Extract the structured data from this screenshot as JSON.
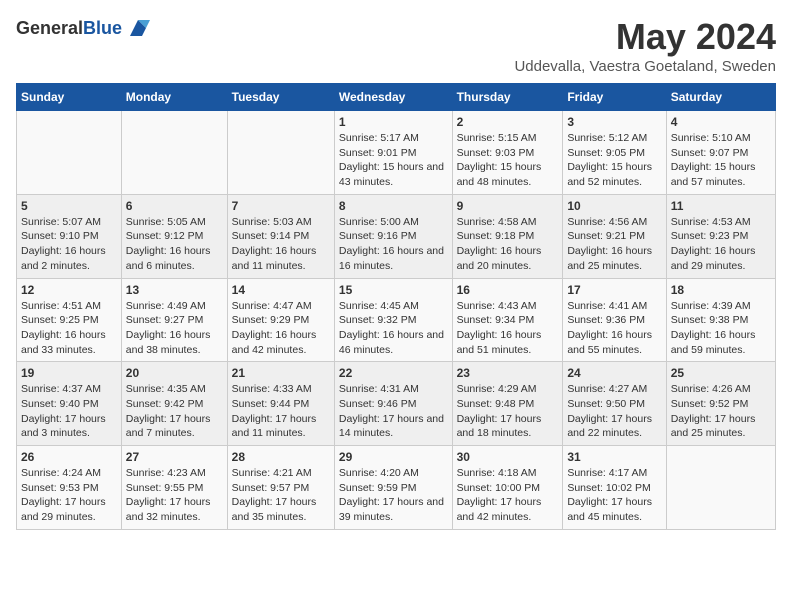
{
  "logo": {
    "general": "General",
    "blue": "Blue"
  },
  "title": "May 2024",
  "subtitle": "Uddevalla, Vaestra Goetaland, Sweden",
  "weekdays": [
    "Sunday",
    "Monday",
    "Tuesday",
    "Wednesday",
    "Thursday",
    "Friday",
    "Saturday"
  ],
  "weeks": [
    [
      {
        "day": "",
        "info": ""
      },
      {
        "day": "",
        "info": ""
      },
      {
        "day": "",
        "info": ""
      },
      {
        "day": "1",
        "info": "Sunrise: 5:17 AM\nSunset: 9:01 PM\nDaylight: 15 hours and 43 minutes."
      },
      {
        "day": "2",
        "info": "Sunrise: 5:15 AM\nSunset: 9:03 PM\nDaylight: 15 hours and 48 minutes."
      },
      {
        "day": "3",
        "info": "Sunrise: 5:12 AM\nSunset: 9:05 PM\nDaylight: 15 hours and 52 minutes."
      },
      {
        "day": "4",
        "info": "Sunrise: 5:10 AM\nSunset: 9:07 PM\nDaylight: 15 hours and 57 minutes."
      }
    ],
    [
      {
        "day": "5",
        "info": "Sunrise: 5:07 AM\nSunset: 9:10 PM\nDaylight: 16 hours and 2 minutes."
      },
      {
        "day": "6",
        "info": "Sunrise: 5:05 AM\nSunset: 9:12 PM\nDaylight: 16 hours and 6 minutes."
      },
      {
        "day": "7",
        "info": "Sunrise: 5:03 AM\nSunset: 9:14 PM\nDaylight: 16 hours and 11 minutes."
      },
      {
        "day": "8",
        "info": "Sunrise: 5:00 AM\nSunset: 9:16 PM\nDaylight: 16 hours and 16 minutes."
      },
      {
        "day": "9",
        "info": "Sunrise: 4:58 AM\nSunset: 9:18 PM\nDaylight: 16 hours and 20 minutes."
      },
      {
        "day": "10",
        "info": "Sunrise: 4:56 AM\nSunset: 9:21 PM\nDaylight: 16 hours and 25 minutes."
      },
      {
        "day": "11",
        "info": "Sunrise: 4:53 AM\nSunset: 9:23 PM\nDaylight: 16 hours and 29 minutes."
      }
    ],
    [
      {
        "day": "12",
        "info": "Sunrise: 4:51 AM\nSunset: 9:25 PM\nDaylight: 16 hours and 33 minutes."
      },
      {
        "day": "13",
        "info": "Sunrise: 4:49 AM\nSunset: 9:27 PM\nDaylight: 16 hours and 38 minutes."
      },
      {
        "day": "14",
        "info": "Sunrise: 4:47 AM\nSunset: 9:29 PM\nDaylight: 16 hours and 42 minutes."
      },
      {
        "day": "15",
        "info": "Sunrise: 4:45 AM\nSunset: 9:32 PM\nDaylight: 16 hours and 46 minutes."
      },
      {
        "day": "16",
        "info": "Sunrise: 4:43 AM\nSunset: 9:34 PM\nDaylight: 16 hours and 51 minutes."
      },
      {
        "day": "17",
        "info": "Sunrise: 4:41 AM\nSunset: 9:36 PM\nDaylight: 16 hours and 55 minutes."
      },
      {
        "day": "18",
        "info": "Sunrise: 4:39 AM\nSunset: 9:38 PM\nDaylight: 16 hours and 59 minutes."
      }
    ],
    [
      {
        "day": "19",
        "info": "Sunrise: 4:37 AM\nSunset: 9:40 PM\nDaylight: 17 hours and 3 minutes."
      },
      {
        "day": "20",
        "info": "Sunrise: 4:35 AM\nSunset: 9:42 PM\nDaylight: 17 hours and 7 minutes."
      },
      {
        "day": "21",
        "info": "Sunrise: 4:33 AM\nSunset: 9:44 PM\nDaylight: 17 hours and 11 minutes."
      },
      {
        "day": "22",
        "info": "Sunrise: 4:31 AM\nSunset: 9:46 PM\nDaylight: 17 hours and 14 minutes."
      },
      {
        "day": "23",
        "info": "Sunrise: 4:29 AM\nSunset: 9:48 PM\nDaylight: 17 hours and 18 minutes."
      },
      {
        "day": "24",
        "info": "Sunrise: 4:27 AM\nSunset: 9:50 PM\nDaylight: 17 hours and 22 minutes."
      },
      {
        "day": "25",
        "info": "Sunrise: 4:26 AM\nSunset: 9:52 PM\nDaylight: 17 hours and 25 minutes."
      }
    ],
    [
      {
        "day": "26",
        "info": "Sunrise: 4:24 AM\nSunset: 9:53 PM\nDaylight: 17 hours and 29 minutes."
      },
      {
        "day": "27",
        "info": "Sunrise: 4:23 AM\nSunset: 9:55 PM\nDaylight: 17 hours and 32 minutes."
      },
      {
        "day": "28",
        "info": "Sunrise: 4:21 AM\nSunset: 9:57 PM\nDaylight: 17 hours and 35 minutes."
      },
      {
        "day": "29",
        "info": "Sunrise: 4:20 AM\nSunset: 9:59 PM\nDaylight: 17 hours and 39 minutes."
      },
      {
        "day": "30",
        "info": "Sunrise: 4:18 AM\nSunset: 10:00 PM\nDaylight: 17 hours and 42 minutes."
      },
      {
        "day": "31",
        "info": "Sunrise: 4:17 AM\nSunset: 10:02 PM\nDaylight: 17 hours and 45 minutes."
      },
      {
        "day": "",
        "info": ""
      }
    ]
  ]
}
